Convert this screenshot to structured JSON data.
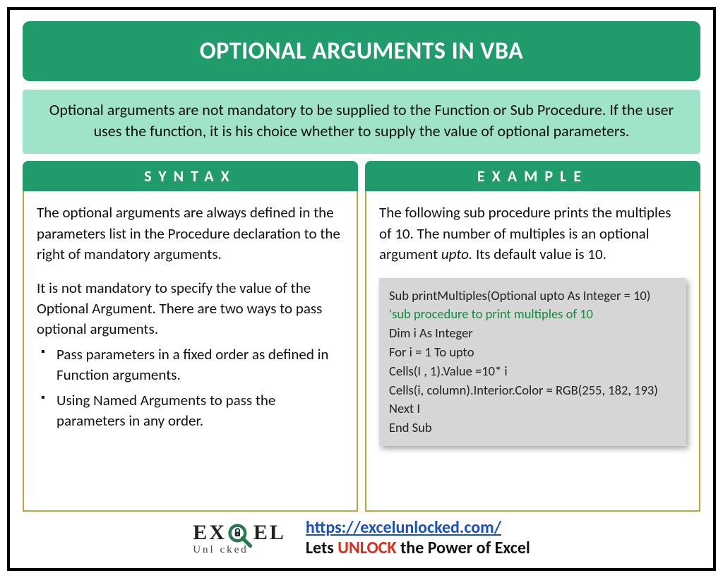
{
  "title": "OPTIONAL ARGUMENTS IN VBA",
  "intro": "Optional arguments are not mandatory to be supplied to the Function or Sub Procedure. If the user uses the function, it is his choice whether to supply the value of optional parameters.",
  "syntax": {
    "header": "SYNTAX",
    "p1": "The optional arguments are always defined in the parameters list in the Procedure declaration to the right of mandatory arguments.",
    "p2": "It is not mandatory to specify the value of the Optional Argument. There are two ways to pass optional arguments.",
    "bullets": [
      "Pass parameters in a fixed order as defined in Function arguments.",
      "Using Named Arguments to pass the parameters in any order."
    ]
  },
  "example": {
    "header": "EXAMPLE",
    "intro_a": "The following sub procedure prints the multiples of 10. The number of multiples is an optional argument ",
    "intro_em": "upto.",
    "intro_b": " Its default value is 10.",
    "code": {
      "l1": "Sub printMultiples(Optional upto As Integer = 10)",
      "l2": " 'sub procedure to print multiples of 10",
      "l3": "Dim i As Integer",
      "l4": "For i = 1 To upto",
      "l5": "Cells(I , 1).Value =10* i",
      "l6": "Cells(i, column).Interior.Color = RGB(255, 182, 193)",
      "l7": "Next I",
      "l8": "End Sub"
    }
  },
  "footer": {
    "logo_top_a": "EX",
    "logo_top_b": "EL",
    "logo_sub": "Unl   cked",
    "url": "https://excelunlocked.com/",
    "tag_a": "Lets ",
    "tag_unlock": "UNLOCK",
    "tag_b": " the Power of Excel"
  }
}
